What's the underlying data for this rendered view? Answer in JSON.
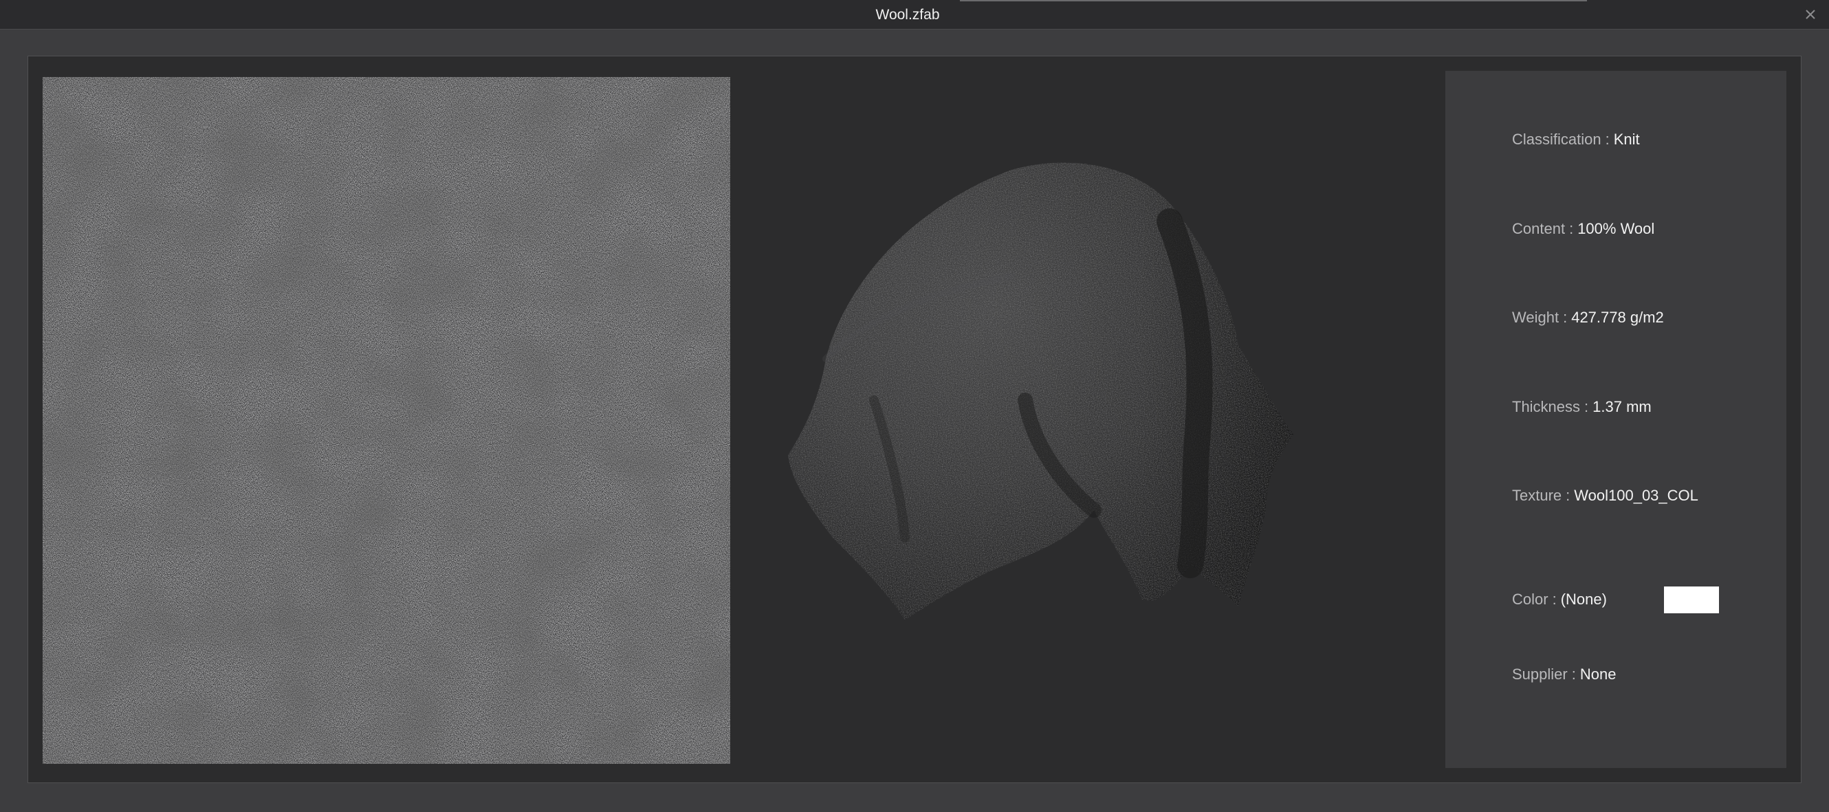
{
  "window": {
    "title": "Wool.zfab",
    "close_icon": "close-icon"
  },
  "swatch": {
    "icon": "fabric-texture-swatch"
  },
  "preview": {
    "icon": "draped-cloth-3d-preview"
  },
  "properties": [
    {
      "key": "classification",
      "label": "Classification",
      "sep": ":",
      "value": "Knit"
    },
    {
      "key": "content",
      "label": "Content",
      "sep": ":",
      "value": "100% Wool"
    },
    {
      "key": "weight",
      "label": "Weight",
      "sep": ":",
      "value": "427.778 g/m2"
    },
    {
      "key": "thickness",
      "label": "Thickness",
      "sep": ":",
      "value": "1.37 mm"
    },
    {
      "key": "texture",
      "label": "Texture",
      "sep": ":",
      "value": "Wool100_03_COL"
    },
    {
      "key": "color",
      "label": "Color",
      "sep": ":",
      "value": "(None)"
    },
    {
      "key": "supplier",
      "label": "Supplier",
      "sep": ":",
      "value": "None"
    }
  ],
  "color_chip": {
    "color": "#ffffff"
  }
}
